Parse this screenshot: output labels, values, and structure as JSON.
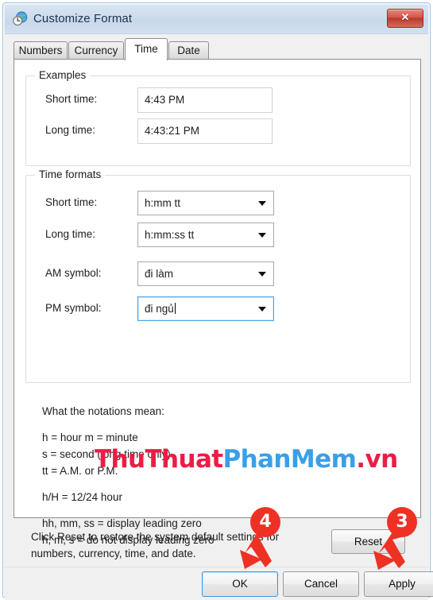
{
  "window": {
    "title": "Customize Format",
    "icon": "region-clock-globe-icon",
    "close_label": "✕"
  },
  "tabs": [
    {
      "label": "Numbers",
      "active": false
    },
    {
      "label": "Currency",
      "active": false
    },
    {
      "label": "Time",
      "active": true
    },
    {
      "label": "Date",
      "active": false
    }
  ],
  "examples": {
    "group_title": "Examples",
    "short_time_label": "Short time:",
    "short_time_value": "4:43 PM",
    "long_time_label": "Long time:",
    "long_time_value": "4:43:21 PM"
  },
  "time_formats": {
    "group_title": "Time formats",
    "short_time_label": "Short time:",
    "short_time_value": "h:mm tt",
    "long_time_label": "Long time:",
    "long_time_value": "h:mm:ss tt",
    "am_symbol_label": "AM symbol:",
    "am_symbol_value": "đi làm",
    "pm_symbol_label": "PM symbol:",
    "pm_symbol_value": "đi ngủ"
  },
  "notations": {
    "heading": "What the notations mean:",
    "line1": "h = hour   m = minute",
    "line2": "s = second (long time only)",
    "line3": "tt = A.M. or P.M.",
    "line4": "h/H = 12/24 hour",
    "line5": "hh, mm, ss = display leading zero",
    "line6": "h, m, s = do not display leading zero"
  },
  "reset": {
    "description_line1": "Click Reset to restore the system default settings for",
    "description_line2": "numbers, currency, time, and date.",
    "button_label": "Reset"
  },
  "footer": {
    "ok_label": "OK",
    "cancel_label": "Cancel",
    "apply_label": "Apply"
  },
  "watermark": {
    "part1": "ThuThuat",
    "part2": "PhanMem",
    "part3": ".vn",
    "color1": "#ed1c45",
    "color2": "#3a9fe8",
    "color3": "#ed1c45"
  },
  "annotations": [
    {
      "number": "4",
      "target": "ok-button"
    },
    {
      "number": "3",
      "target": "apply-button"
    }
  ],
  "colors": {
    "titlebar": "#cddcee",
    "dialog_bg": "#f0f0f0",
    "page_bg": "#ffffff",
    "accent_focus": "#4fa3e3",
    "annotation_red": "#ee3124"
  }
}
